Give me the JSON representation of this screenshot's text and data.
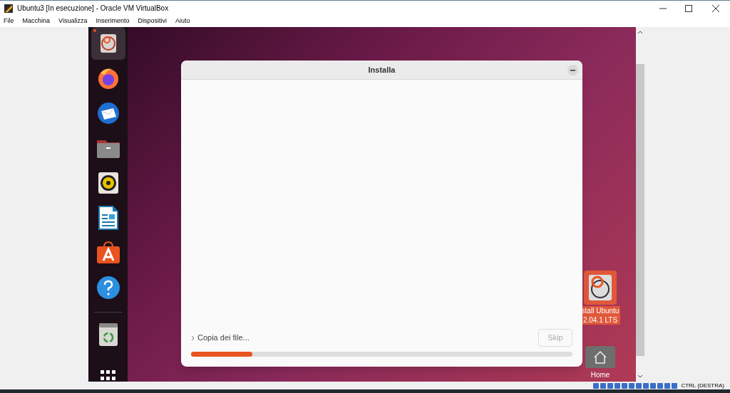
{
  "window": {
    "title": "Ubuntu3 [In esecuzione] - Oracle VM VirtualBox"
  },
  "menu": [
    "File",
    "Macchina",
    "Visualizza",
    "Inserimento",
    "Dispositivi",
    "Aiuto"
  ],
  "dock": [
    {
      "kind": "installer",
      "selected": true
    },
    {
      "kind": "browser",
      "selected": false
    },
    {
      "kind": "mail",
      "selected": false
    },
    {
      "kind": "files",
      "selected": false
    },
    {
      "kind": "music",
      "selected": false
    },
    {
      "kind": "writer",
      "selected": false
    },
    {
      "kind": "store",
      "selected": false
    },
    {
      "kind": "help",
      "selected": false
    },
    {
      "kind": "trash",
      "selected": false
    }
  ],
  "dialog": {
    "title": "Installa",
    "step": "Copia dei file...",
    "skip_button": "Skip",
    "progress": {
      "level": 0.16
    }
  },
  "desktop_icons": [
    {
      "kind": "installer",
      "lines": [
        "stall Ubuntu",
        "2.04.1 LTS"
      ]
    },
    {
      "kind": "home",
      "lines": [
        "Home"
      ]
    }
  ],
  "status_bar": {
    "host_key": "CTRL (DESTRA)"
  }
}
